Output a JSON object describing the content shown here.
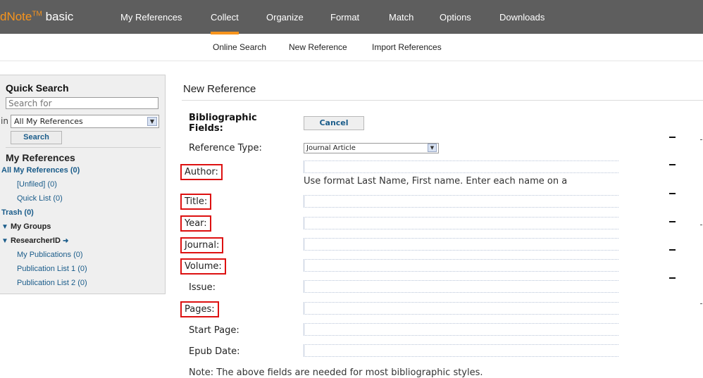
{
  "app": {
    "brand_prefix": "dNote",
    "brand_tm": "TM",
    "brand_suffix": "basic"
  },
  "nav": {
    "items": [
      "My References",
      "Collect",
      "Organize",
      "Format",
      "Match",
      "Options",
      "Downloads"
    ],
    "active": "Collect"
  },
  "subnav": {
    "online_search": "Online Search",
    "new_reference": "New Reference",
    "import_references": "Import References"
  },
  "sidebar": {
    "quick_search_title": "Quick Search",
    "search_placeholder": "Search for",
    "in_label": "in",
    "scope_value": "All My References",
    "search_button": "Search",
    "my_references_title": "My References",
    "all_refs": "All My References (0)",
    "unfiled": "[Unfiled] (0)",
    "quick_list": "Quick List (0)",
    "trash": "Trash (0)",
    "my_groups": "My Groups",
    "researcher_id": "ResearcherID",
    "my_publications": "My Publications (0)",
    "publication_list_1": "Publication List 1 (0)",
    "publication_list_2": "Publication List 2 (0)"
  },
  "main": {
    "title": "New Reference",
    "bib_fields_line1": "Bibliographic",
    "bib_fields_line2": "Fields:",
    "cancel_button": "Cancel",
    "reference_type_label": "Reference Type:",
    "reference_type_value": "Journal Article",
    "fields": {
      "author": "Author:",
      "title": "Title:",
      "year": "Year:",
      "journal": "Journal:",
      "volume": "Volume:",
      "issue": "Issue:",
      "pages": "Pages:",
      "start_page": "Start Page:",
      "epub_date": "Epub Date:"
    },
    "author_hint": "Use format Last Name, First name. Enter each name on a",
    "note": "Note: The above fields are needed for most bibliographic styles."
  },
  "colors": {
    "topbar": "#5e5e5e",
    "accent": "#f7941d",
    "link": "#1a5c8a",
    "highlight_border": "#dd1111"
  }
}
